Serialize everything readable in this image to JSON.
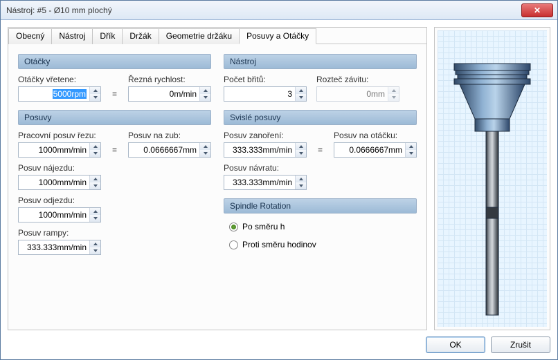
{
  "window": {
    "title": "Nástroj: #5 - Ø10 mm plochý"
  },
  "tabs": {
    "general": "Obecný",
    "tool": "Nástroj",
    "shaft": "Dřík",
    "holder": "Držák",
    "holder_geom": "Geometrie držáku",
    "feeds_speeds": "Posuvy a Otáčky"
  },
  "sections": {
    "rpm": "Otáčky",
    "tool": "Nástroj",
    "feeds": "Posuvy",
    "vertical_feeds": "Svislé posuvy",
    "spindle": "Spindle Rotation"
  },
  "labels": {
    "spindle_speed": "Otáčky vřetene:",
    "cutting_speed": "Řezná rychlost:",
    "flutes": "Počet břitů:",
    "thread_pitch": "Rozteč závitu:",
    "cutting_feed": "Pracovní posuv řezu:",
    "feed_per_tooth": "Posuv na zub:",
    "plunge_feed": "Posuv zanoření:",
    "feed_per_rev": "Posuv na otáčku:",
    "lead_in": "Posuv nájezdu:",
    "retract": "Posuv návratu:",
    "lead_out": "Posuv odjezdu:",
    "ramp": "Posuv rampy:"
  },
  "values": {
    "spindle_speed_pre": "",
    "spindle_speed_sel": "5000rpm",
    "spindle_speed_post": "",
    "cutting_speed": "0m/min",
    "flutes": "3",
    "thread_pitch": "0mm",
    "cutting_feed": "1000mm/min",
    "feed_per_tooth": "0.0666667mm",
    "plunge_feed": "333.333mm/min",
    "feed_per_rev": "0.0666667mm",
    "lead_in": "1000mm/min",
    "retract": "333.333mm/min",
    "lead_out": "1000mm/min",
    "ramp": "333.333mm/min"
  },
  "radios": {
    "cw": "Po směru h",
    "ccw": "Proti směru hodinov"
  },
  "buttons": {
    "ok": "OK",
    "cancel": "Zrušit",
    "eq": "="
  }
}
